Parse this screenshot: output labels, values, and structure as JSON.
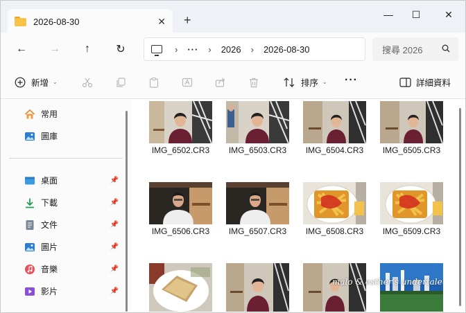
{
  "window": {
    "tab_title": "2026-08-30",
    "new_tab": "+",
    "minimize": "—",
    "maximize": "☐",
    "close": "✕"
  },
  "nav": {
    "back": "←",
    "forward": "→",
    "up": "↑",
    "refresh": "↻",
    "breadcrumb": [
      "2026",
      "2026-08-30"
    ],
    "overflow": "···",
    "search_placeholder": "搜尋 2026"
  },
  "toolbar": {
    "new_label": "新增",
    "sort_label": "排序",
    "more": "···",
    "details_label": "詳細資料"
  },
  "sidebar": {
    "top_items": [
      {
        "label": "常用",
        "icon": "home-icon"
      },
      {
        "label": "圖庫",
        "icon": "gallery-icon"
      }
    ],
    "pinned_items": [
      {
        "label": "桌面",
        "icon": "desktop-icon"
      },
      {
        "label": "下載",
        "icon": "download-icon"
      },
      {
        "label": "文件",
        "icon": "document-icon"
      },
      {
        "label": "圖片",
        "icon": "pictures-icon"
      },
      {
        "label": "音樂",
        "icon": "music-icon"
      },
      {
        "label": "影片",
        "icon": "video-icon"
      }
    ]
  },
  "files": [
    {
      "name": "IMG_6502.CR3",
      "scene": "woman-window"
    },
    {
      "name": "IMG_6503.CR3",
      "scene": "woman-window"
    },
    {
      "name": "IMG_6504.CR3",
      "scene": "woman-cafe"
    },
    {
      "name": "IMG_6505.CR3",
      "scene": "woman-cafe"
    },
    {
      "name": "IMG_6506.CR3",
      "scene": "man-cafe"
    },
    {
      "name": "IMG_6507.CR3",
      "scene": "man-cafe"
    },
    {
      "name": "IMG_6508.CR3",
      "scene": "fries"
    },
    {
      "name": "IMG_6509.CR3",
      "scene": "fries"
    },
    {
      "name": "",
      "scene": "toast"
    },
    {
      "name": "",
      "scene": "woman-cafe"
    },
    {
      "name": "",
      "scene": "woman-cafe"
    },
    {
      "name": "",
      "scene": "city"
    }
  ],
  "watermark": "malo & esther's undertale",
  "colors": {
    "accent": "#0067c0",
    "folder": "#f7c14a",
    "titlebar_bg": "#eef1f6",
    "panel_bg": "#fbfbfb"
  }
}
